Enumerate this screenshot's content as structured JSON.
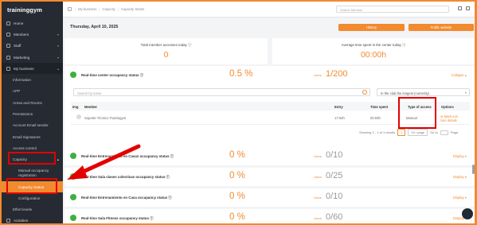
{
  "app": {
    "logo": "traininggym"
  },
  "sidebar": {
    "items": [
      {
        "label": "Home",
        "icon": "home-icon"
      },
      {
        "label": "Members",
        "icon": "members-icon"
      },
      {
        "label": "Staff",
        "icon": "staff-icon"
      },
      {
        "label": "Marketing",
        "icon": "megaphone-icon"
      },
      {
        "label": "My business",
        "icon": "business-icon"
      }
    ],
    "business_sub": [
      "Information",
      "APP",
      "Areas and Rooms",
      "Permissions",
      "Account Email sender",
      "Email Signatures",
      "Access control"
    ],
    "capacity_label": "Capacity",
    "capacity_sub": [
      "Manual occupancy registration",
      "Capacity Status",
      "Configuration"
    ],
    "after_sub": [
      "Effort levels"
    ],
    "bottom_item": "Activities"
  },
  "breadcrumb": [
    "My business",
    "Capacity",
    "Capacity Status"
  ],
  "topbar": {
    "search_placeholder": "Search Member"
  },
  "header": {
    "date": "Thursday, April 10, 2025",
    "history_btn": "History",
    "public_btn": "Public website"
  },
  "metrics": [
    {
      "title": "Total member accesses today ⓘ",
      "value": "0"
    },
    {
      "title": "Average time spent in the center today ⓘ",
      "value": "00:00h"
    }
  ],
  "realtime": {
    "title": "Real-time center occupancy status ⓘ",
    "percent": "0.5 %",
    "users_label": "Users",
    "users_value": "1/200",
    "collapse": "Collapse ▴",
    "search_placeholder": "Search by name",
    "filter_value": "In the club the longest (currently)",
    "columns": [
      "Img",
      "Member",
      "Entry",
      "Time spent",
      "Type of access",
      "Options"
    ],
    "rows": [
      {
        "member": "Soporte Técnico Trainingym",
        "entry": "17:04h",
        "time_spent": "00:03h",
        "type": "Manual",
        "opt1": "⊗ Mark exit",
        "opt2": "See details"
      }
    ],
    "pager": {
      "showing": "Showing 1 - 1 of 1 results",
      "page": "1",
      "per_page": "10 / page",
      "goto": "Go to",
      "page_label": "Page"
    }
  },
  "rooms": [
    {
      "title": "Real-time Entrenamiento en Casa1 occupancy status ⓘ",
      "percent": "0 %",
      "users": "0/10"
    },
    {
      "title": "Real-time Sala clases colectivas occupancy status ⓘ",
      "percent": "0 %",
      "users": "0/25"
    },
    {
      "title": "Real-time Entrenamiento en Casa occupancy status ⓘ",
      "percent": "0 %",
      "users": "0/10"
    },
    {
      "title": "Real-time Sala Fitness occupancy status ⓘ",
      "percent": "0 %",
      "users": "0/60"
    }
  ],
  "room_labels": {
    "users": "Users",
    "display": "Display ▾"
  },
  "colors": {
    "accent": "#f28a2f",
    "sidebar": "#262b33",
    "status_green": "#3cb043",
    "annotation_red": "#e30000"
  }
}
